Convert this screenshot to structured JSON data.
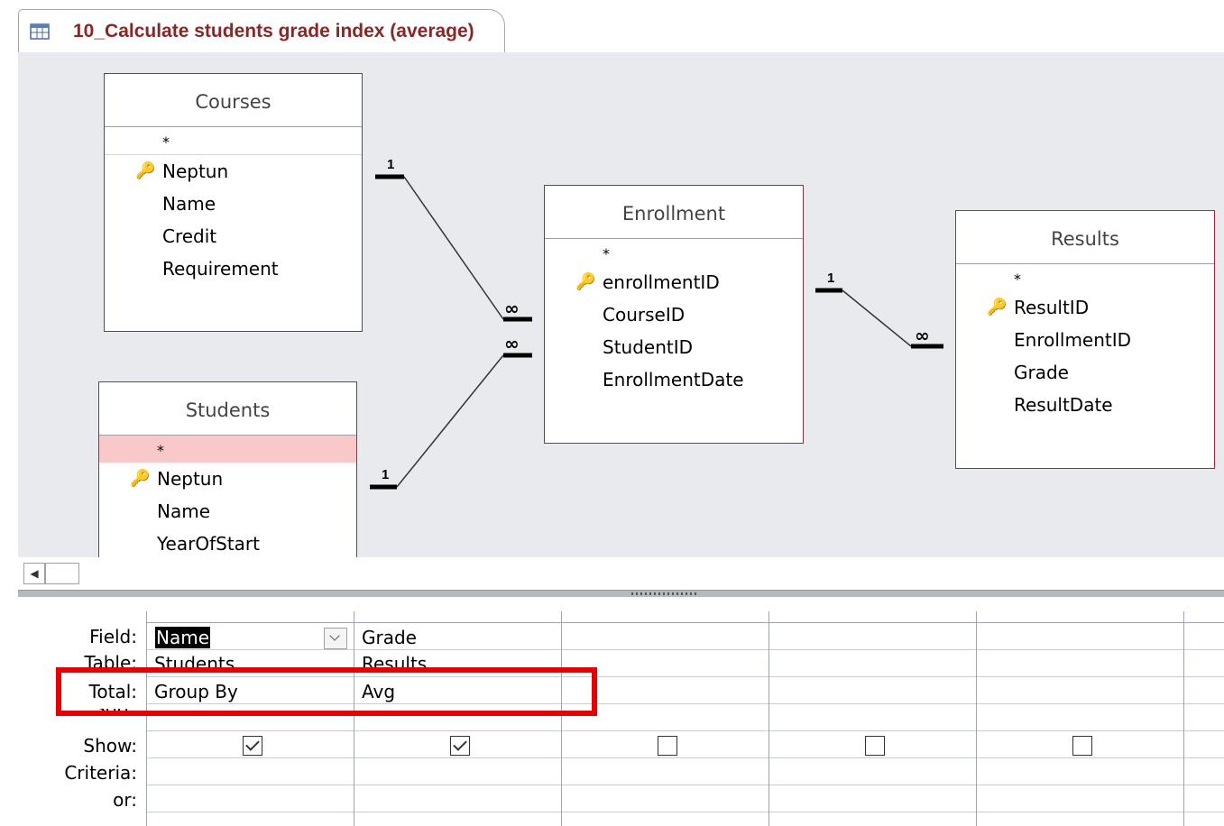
{
  "tab": {
    "icon": "query-icon",
    "title": "10_Calculate students grade index (average)"
  },
  "tables": {
    "courses": {
      "title": "Courses",
      "star": "*",
      "fields": [
        {
          "name": "Neptun",
          "key": true
        },
        {
          "name": "Name"
        },
        {
          "name": "Credit"
        },
        {
          "name": "Requirement"
        }
      ]
    },
    "enrollment": {
      "title": "Enrollment",
      "star": "*",
      "fields": [
        {
          "name": "enrollmentID",
          "key": true
        },
        {
          "name": "CourseID"
        },
        {
          "name": "StudentID"
        },
        {
          "name": "EnrollmentDate"
        }
      ]
    },
    "results": {
      "title": "Results",
      "star": "*",
      "fields": [
        {
          "name": "ResultID",
          "key": true
        },
        {
          "name": "EnrollmentID"
        },
        {
          "name": "Grade"
        },
        {
          "name": "ResultDate"
        }
      ]
    },
    "students": {
      "title": "Students",
      "star": "*",
      "fields": [
        {
          "name": "Neptun",
          "key": true
        },
        {
          "name": "Name"
        },
        {
          "name": "YearOfStart"
        }
      ]
    }
  },
  "relationships": {
    "one_label": "1",
    "many_label": "∞"
  },
  "grid": {
    "row_labels": {
      "field": "Field:",
      "table": "Table:",
      "total": "Total:",
      "sort": "Sort:",
      "show": "Show:",
      "criteria": "Criteria:",
      "or": "or:"
    },
    "columns": [
      {
        "field": "Name",
        "table": "Students",
        "total": "Group By",
        "show": true
      },
      {
        "field": "Grade",
        "table": "Results",
        "total": "Avg",
        "show": true
      },
      {
        "field": "",
        "table": "",
        "total": "",
        "show": false
      },
      {
        "field": "",
        "table": "",
        "total": "",
        "show": false
      },
      {
        "field": "",
        "table": "",
        "total": "",
        "show": false
      }
    ]
  },
  "colors": {
    "highlight": "#e60000",
    "table_border": "#a32b34",
    "title_text": "#8a2626"
  }
}
